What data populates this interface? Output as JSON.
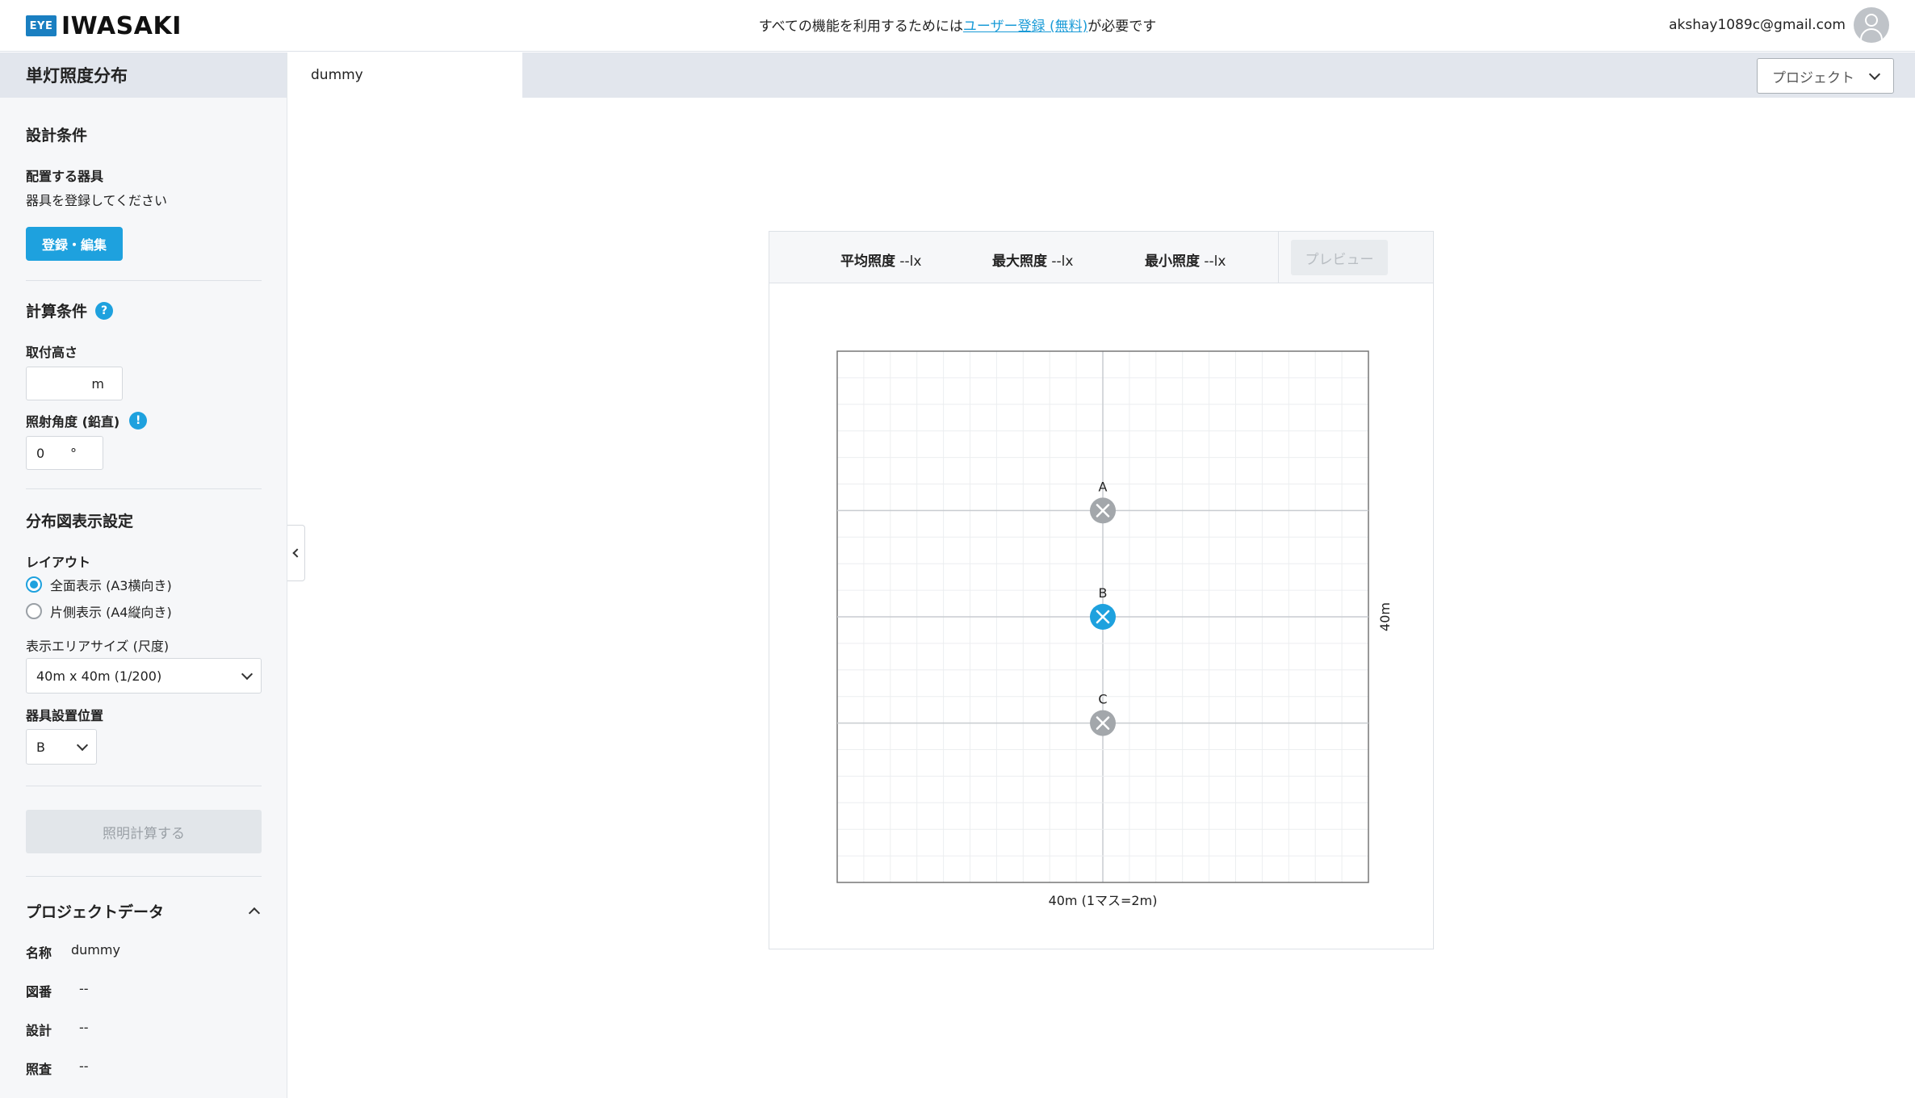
{
  "header": {
    "logo_eye": "EYE",
    "logo_text": "IWASAKI",
    "notice_before": "すべての機能を利用するためには",
    "notice_link": "ユーザー登録 (無料)",
    "notice_after": "が必要です",
    "email": "akshay1089c@gmail.com"
  },
  "sidebar": {
    "title": "単灯照度分布",
    "design": {
      "title": "設計条件",
      "fixture_label": "配置する器具",
      "fixture_text": "器具を登録してください",
      "register_button": "登録・編集"
    },
    "calc": {
      "title": "計算条件",
      "height_label": "取付高さ",
      "height_value": "",
      "height_unit": "m",
      "angle_label": "照射角度 (鉛直)",
      "angle_value": "0",
      "angle_unit": "°"
    },
    "display": {
      "title": "分布図表示設定",
      "layout_label": "レイアウト",
      "layout_option_1": "全面表示 (A3横向き)",
      "layout_option_2": "片側表示 (A4縦向き)",
      "area_label": "表示エリアサイズ (尺度)",
      "area_value": "40m x 40m (1/200)",
      "position_label": "器具設置位置",
      "position_value": "B"
    },
    "calc_button": "照明計算する",
    "project": {
      "title": "プロジェクトデータ",
      "name_key": "名称",
      "name_value": "dummy",
      "drawing_key": "図番",
      "drawing_value": "--",
      "design_key": "設計",
      "design_value": "--",
      "check_key": "照査",
      "check_value": "--"
    }
  },
  "tabs": {
    "active": "dummy",
    "project_button": "プロジェクト"
  },
  "panel": {
    "avg_label": "平均照度",
    "avg_value": "--lx",
    "max_label": "最大照度",
    "max_value": "--lx",
    "min_label": "最小照度",
    "min_value": "--lx",
    "preview_button": "プレビュー",
    "x_label": "40m (1マス=2m)",
    "y_label": "40m",
    "points": [
      {
        "label": "A",
        "selected": false
      },
      {
        "label": "B",
        "selected": true
      },
      {
        "label": "C",
        "selected": false
      }
    ]
  },
  "colors": {
    "accent": "#1ea1de",
    "point_inactive": "#a3a7ab"
  }
}
